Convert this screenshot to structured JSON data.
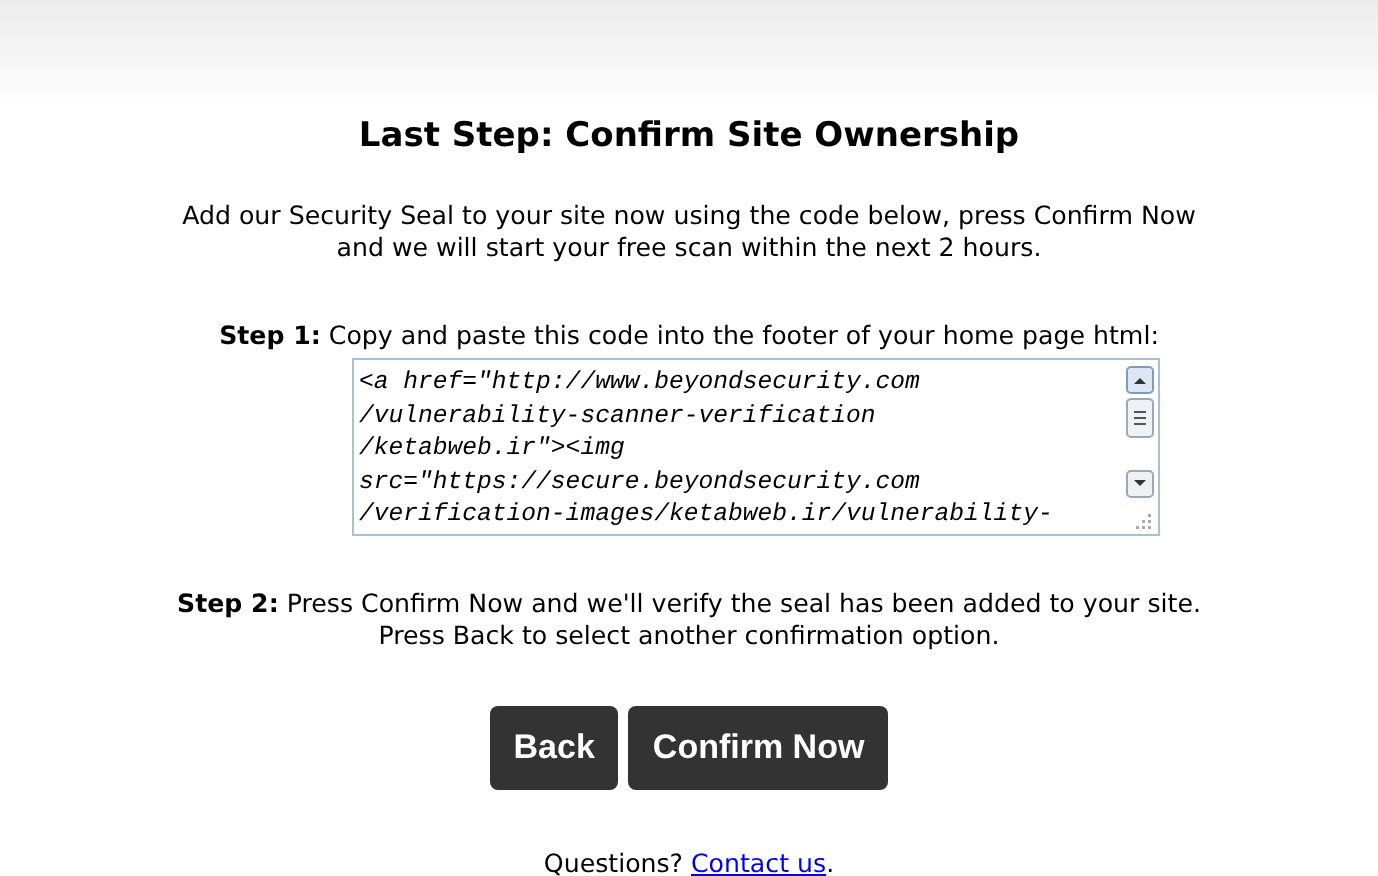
{
  "title": "Last Step: Confirm Site Ownership",
  "intro": "Add our Security Seal to your site now using the code below, press Confirm Now\nand we will start your free scan within the next 2 hours.",
  "step1": "**Step 1:** Copy and paste this code into the footer of your home page html:",
  "code_lines": [
    "<a href=\"http://www.beyondsecurity.com",
    "/vulnerability-scanner-verification",
    "/ketabweb.ir\"><img",
    "src=\"https://secure.beyondsecurity.com",
    "/verification-images/ketabweb.ir/vulnerability-"
  ],
  "step2": "**Step 2:** Press Confirm Now and we'll verify the seal has been added to your site.\nPress Back to select another confirmation option.",
  "buttons": [
    "Back",
    "Confirm Now"
  ],
  "footer": {
    "text": "Questions?",
    "link": "Contact us",
    "end": "."
  }
}
